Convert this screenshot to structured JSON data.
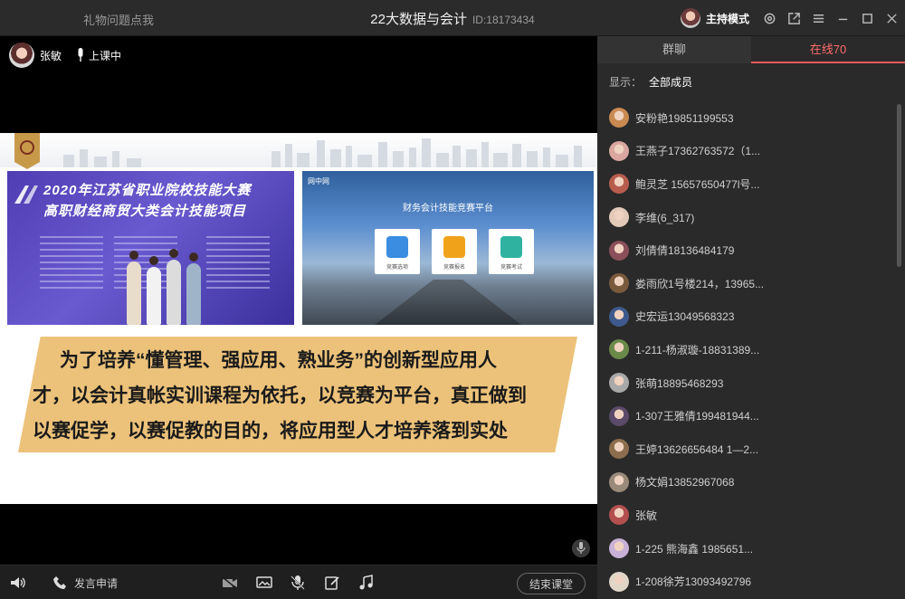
{
  "titlebar": {
    "left_text": "礼物问题点我",
    "title": "22大数据与会计",
    "id_text": "ID:18173434",
    "mode": "主持模式",
    "icons": [
      "settings-icon",
      "popout-icon",
      "menu-icon",
      "minimize-icon",
      "maximize-icon",
      "close-icon"
    ]
  },
  "presenter": {
    "name": "张敏",
    "status": "上课中"
  },
  "slide": {
    "photo_title_1": "2020年江苏省职业院校技能大赛",
    "photo_title_2": "高职财经商贸大类会计技能项目",
    "platform_logo": "网中网",
    "platform_title": "财务会计技能竞赛平台",
    "platform_cards": [
      "竞赛选项",
      "竞赛报名",
      "竞赛考试"
    ],
    "banner_line_1": "为了培养“懂管理、强应用、熟业务”的创新型应用人",
    "banner_line_2": "才，以会计真帐实训课程为依托，以竞赛为平台，真正做到",
    "banner_line_3": "以赛促学，以赛促教的目的，将应用型人才培养落到实处"
  },
  "bottombar": {
    "speak_request": "发言申请",
    "end_class": "结束课堂"
  },
  "side": {
    "tab_chat": "群聊",
    "tab_online": "在线70",
    "filter_label": "显示：",
    "filter_value": "全部成员",
    "members": [
      {
        "name": "安粉艳19851199553",
        "color": "#c98a52"
      },
      {
        "name": "王燕子17362763572（1...",
        "color": "#d9a7a0"
      },
      {
        "name": "鲍灵芝 15657650477l号...",
        "color": "#b85d4e"
      },
      {
        "name": "李维(6_317)",
        "color": "#e2c9b8"
      },
      {
        "name": "刘倩倩18136484179",
        "color": "#8a4f5a"
      },
      {
        "name": "娄雨欣1号楼214，13965...",
        "color": "#7a5a3c"
      },
      {
        "name": "史宏运13049568323",
        "color": "#3e5a8c"
      },
      {
        "name": "1-211-杨淑璇-18831389...",
        "color": "#6b8a4a"
      },
      {
        "name": "张萌18895468293",
        "color": "#a9a9a9"
      },
      {
        "name": "1-307王雅倩199481944...",
        "color": "#5c4a6a"
      },
      {
        "name": "王婷13626656484 1—2...",
        "color": "#8c6e4e"
      },
      {
        "name": "杨文娟13852967068",
        "color": "#9a8a7a"
      },
      {
        "name": "张敏",
        "color": "#b34f4f"
      },
      {
        "name": "1-225 熊海鑫 1985651...",
        "color": "#c7b1d6"
      },
      {
        "name": "1-208徐芳13093492796",
        "color": "#e0d6c8"
      }
    ]
  }
}
